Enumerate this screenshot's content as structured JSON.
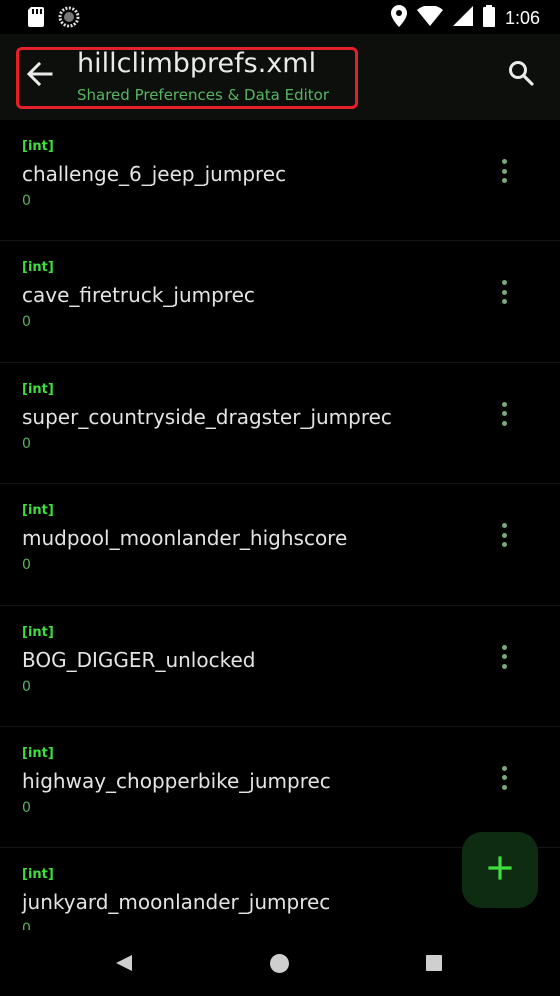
{
  "status_bar": {
    "time": "1:06",
    "icons": [
      "sd-card-icon",
      "sync-circle-icon",
      "location-icon",
      "wifi-icon",
      "signal-icon",
      "battery-icon"
    ]
  },
  "app_bar": {
    "title": "hillclimbprefs.xml",
    "subtitle": "Shared Preferences & Data Editor",
    "back_icon": "arrow-left-icon",
    "search_icon": "search-icon"
  },
  "items": [
    {
      "type": "[int]",
      "key": "challenge_6_jeep_jumprec",
      "value": "0"
    },
    {
      "type": "[int]",
      "key": "cave_firetruck_jumprec",
      "value": "0"
    },
    {
      "type": "[int]",
      "key": "super_countryside_dragster_jumprec",
      "value": "0"
    },
    {
      "type": "[int]",
      "key": "mudpool_moonlander_highscore",
      "value": "0"
    },
    {
      "type": "[int]",
      "key": "BOG_DIGGER_unlocked",
      "value": "0"
    },
    {
      "type": "[int]",
      "key": "highway_chopperbike_jumprec",
      "value": "0"
    },
    {
      "type": "[int]",
      "key": "junkyard_moonlander_jumprec",
      "value": "0"
    }
  ],
  "fab": {
    "icon": "plus-icon"
  },
  "nav_bar": {
    "icons": [
      "nav-back-icon",
      "nav-home-icon",
      "nav-recents-icon"
    ]
  },
  "colors": {
    "accent_green": "#3ede3e",
    "subtitle_green": "#57b561",
    "highlight_red": "#e6202a",
    "fab_bg": "#0d2c11"
  }
}
